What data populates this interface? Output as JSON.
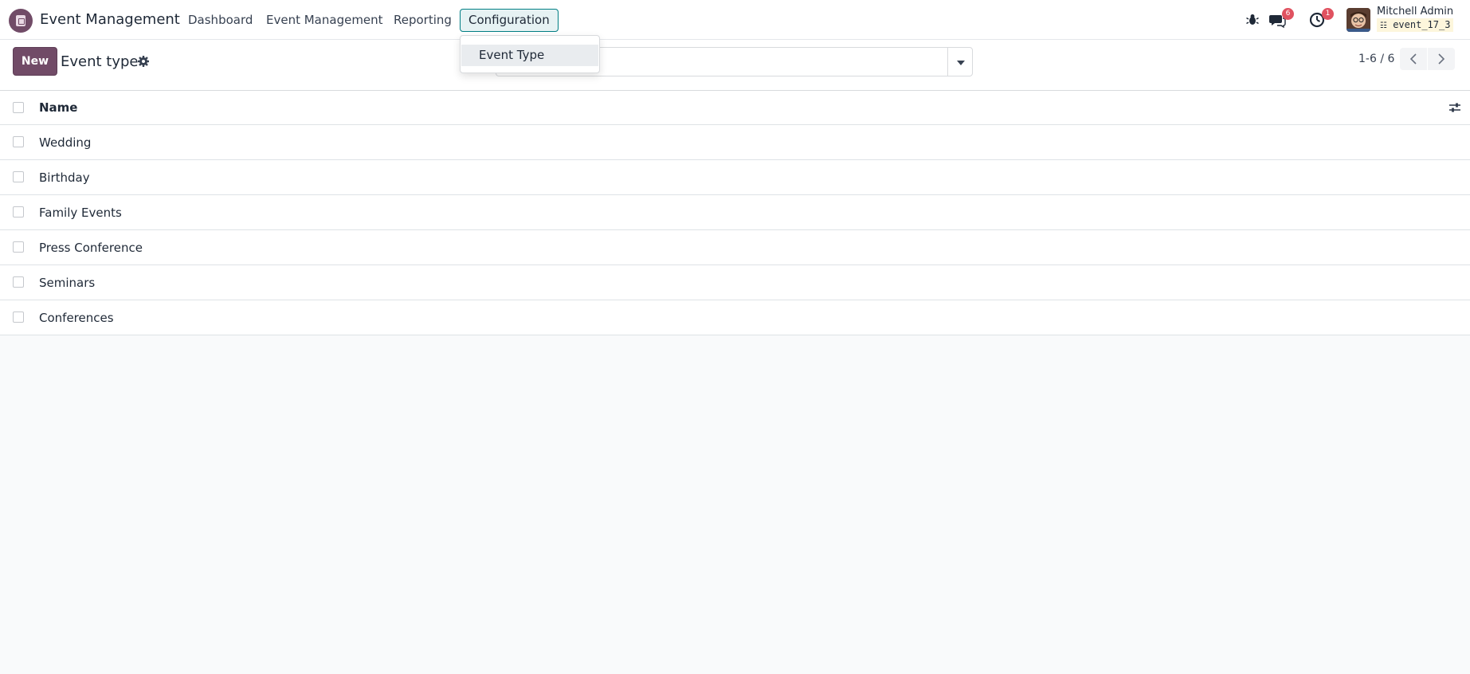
{
  "navbar": {
    "app_name": "Event Management",
    "menu": [
      {
        "label": "Dashboard"
      },
      {
        "label": "Event Management"
      },
      {
        "label": "Reporting"
      },
      {
        "label": "Configuration"
      }
    ],
    "messages_count": "6",
    "activities_count": "1",
    "user_name": "Mitchell Admin",
    "db_name": "event_17_3"
  },
  "control_panel": {
    "new_label": "New",
    "title": "Event type",
    "search_placeholder": "",
    "pager": "1-6 / 6"
  },
  "dropdown": {
    "items": [
      {
        "label": "Event Type"
      }
    ]
  },
  "list": {
    "column_name": "Name",
    "rows": [
      {
        "name": "Wedding"
      },
      {
        "name": "Birthday"
      },
      {
        "name": "Family Events"
      },
      {
        "name": "Press Conference"
      },
      {
        "name": "Seminars"
      },
      {
        "name": "Conferences"
      }
    ]
  },
  "colors": {
    "brand": "#714b67",
    "active_menu_border": "#017e84",
    "badge": "#e05260"
  }
}
